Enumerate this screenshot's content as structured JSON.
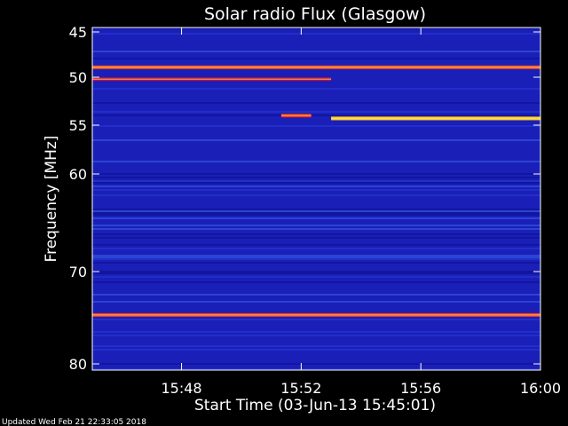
{
  "chart_data": {
    "type": "heatmap",
    "title": "Solar radio Flux (Glasgow)",
    "xlabel": "Start Time (03-Jun-13 15:45:01)",
    "ylabel": "Frequency [MHz]",
    "footer": "Updated Wed Feb 21 22:33:05 2018",
    "x_range_minutes": [
      "15:45:01",
      "16:00"
    ],
    "y_range_mhz": [
      45,
      80
    ],
    "y_axis_inverted": true,
    "x_ticks": [
      "15:48",
      "15:52",
      "15:56",
      "16:00"
    ],
    "y_ticks": [
      45,
      50,
      55,
      60,
      70,
      80
    ],
    "colormap": "blue-red-yellow",
    "background_color": "#1a1fb8",
    "emission_lines": [
      {
        "freq_mhz": 48.9,
        "start": "15:45:01",
        "end": "16:00",
        "color": "#ff4a1a"
      },
      {
        "freq_mhz": 50.2,
        "start": "15:45:01",
        "end": "15:53:00",
        "color": "#c01040"
      },
      {
        "freq_mhz": 54.0,
        "start": "15:51:20",
        "end": "15:52:20",
        "color": "#ff3010"
      },
      {
        "freq_mhz": 54.3,
        "start": "15:53:00",
        "end": "16:00",
        "color": "#ffd020"
      },
      {
        "freq_mhz": 74.7,
        "start": "15:45:01",
        "end": "16:00",
        "color": "#ff3b1a"
      }
    ]
  }
}
